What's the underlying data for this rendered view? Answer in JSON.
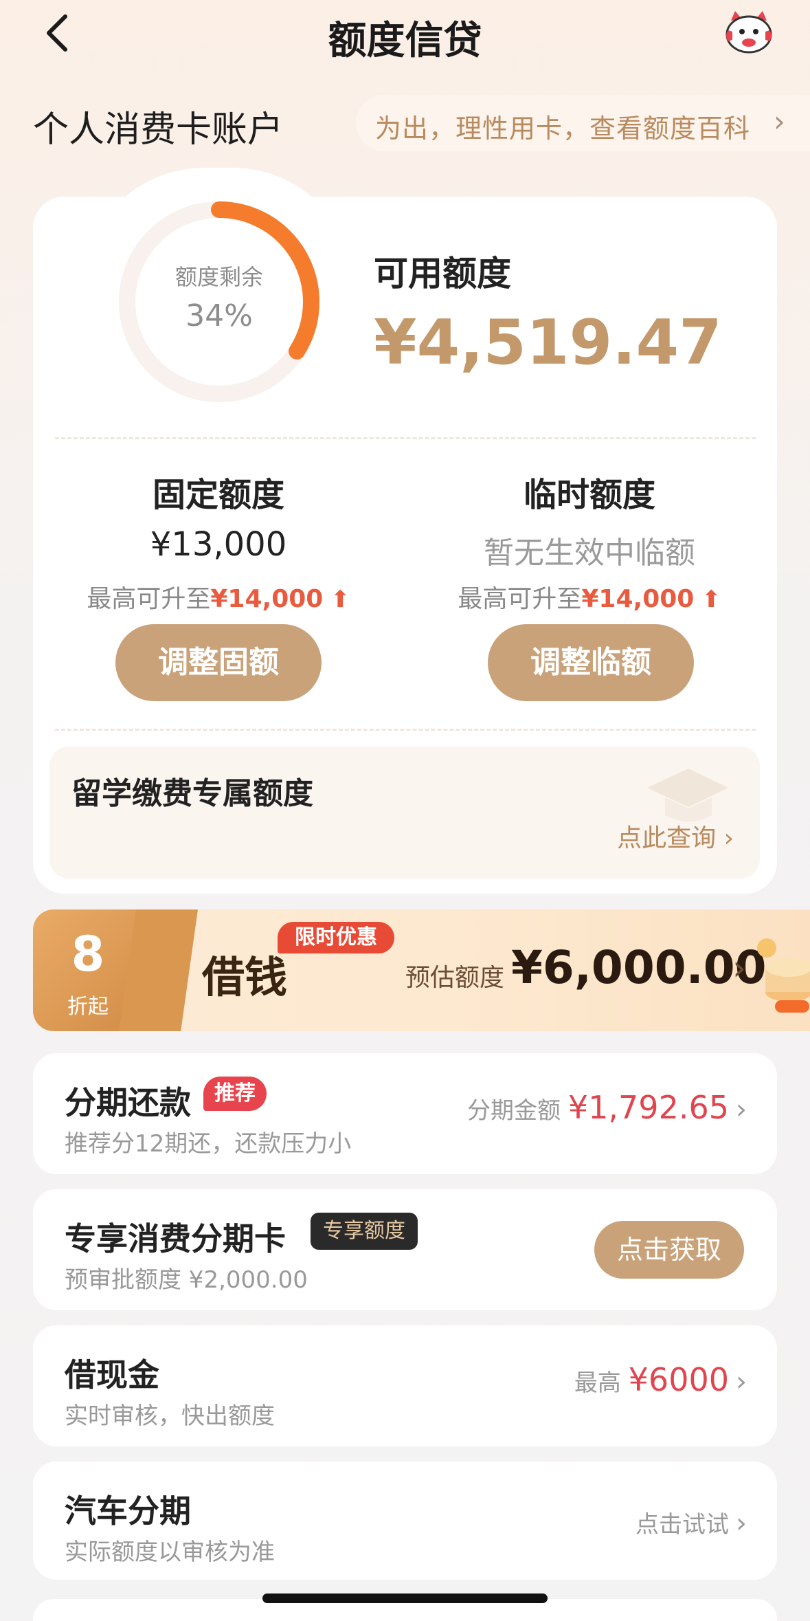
{
  "header": {
    "title": "额度信贷",
    "back_icon": "chevron-left-icon",
    "mascot_icon": "mascot-icon"
  },
  "account": {
    "title": "个人消费卡账户",
    "notice": "为出，理性用卡，查看额度百科",
    "notice_chevron": "›"
  },
  "credit": {
    "ring_label": "额度剩余",
    "ring_percent": "34%",
    "ring_fraction": 0.34,
    "available_label": "可用额度",
    "available_amount": "¥4,519.47",
    "fixed": {
      "title": "固定额度",
      "value": "¥13,000",
      "max_prefix": "最高可升至",
      "max_value": "¥14,000",
      "button": "调整固额"
    },
    "temp": {
      "title": "临时额度",
      "value": "暂无生效中临额",
      "max_prefix": "最高可升至",
      "max_value": "¥14,000",
      "button": "调整临额"
    }
  },
  "study": {
    "title": "留学缴费专属额度",
    "link": "点此查询 ›"
  },
  "loan_banner": {
    "discount_num": "8",
    "discount_unit": "折起",
    "title": "借钱",
    "tag": "限时优惠",
    "est_label": "预估额度",
    "est_amount": "¥6,000.00",
    "chevron": "›"
  },
  "rows": [
    {
      "title": "分期还款",
      "badge": "推荐",
      "sub": "推荐分12期还，还款压力小",
      "right_label": "分期金额",
      "right_amount": "¥1,792.65",
      "chevron": "›"
    },
    {
      "title": "专享消费分期卡",
      "badge": "专享额度",
      "sub": "预审批额度 ¥2,000.00",
      "button": "点击获取"
    },
    {
      "title": "借现金",
      "sub": "实时审核，快出额度",
      "right_label": "最高",
      "right_amount": "¥6000",
      "chevron": "›"
    },
    {
      "title": "汽车分期",
      "sub": "实际额度以审核为准",
      "right_label": "点击试试",
      "chevron": "›"
    }
  ],
  "colors": {
    "accent_gold": "#c9a27a",
    "ring_orange": "#f47c2c",
    "red": "#e0454e"
  }
}
